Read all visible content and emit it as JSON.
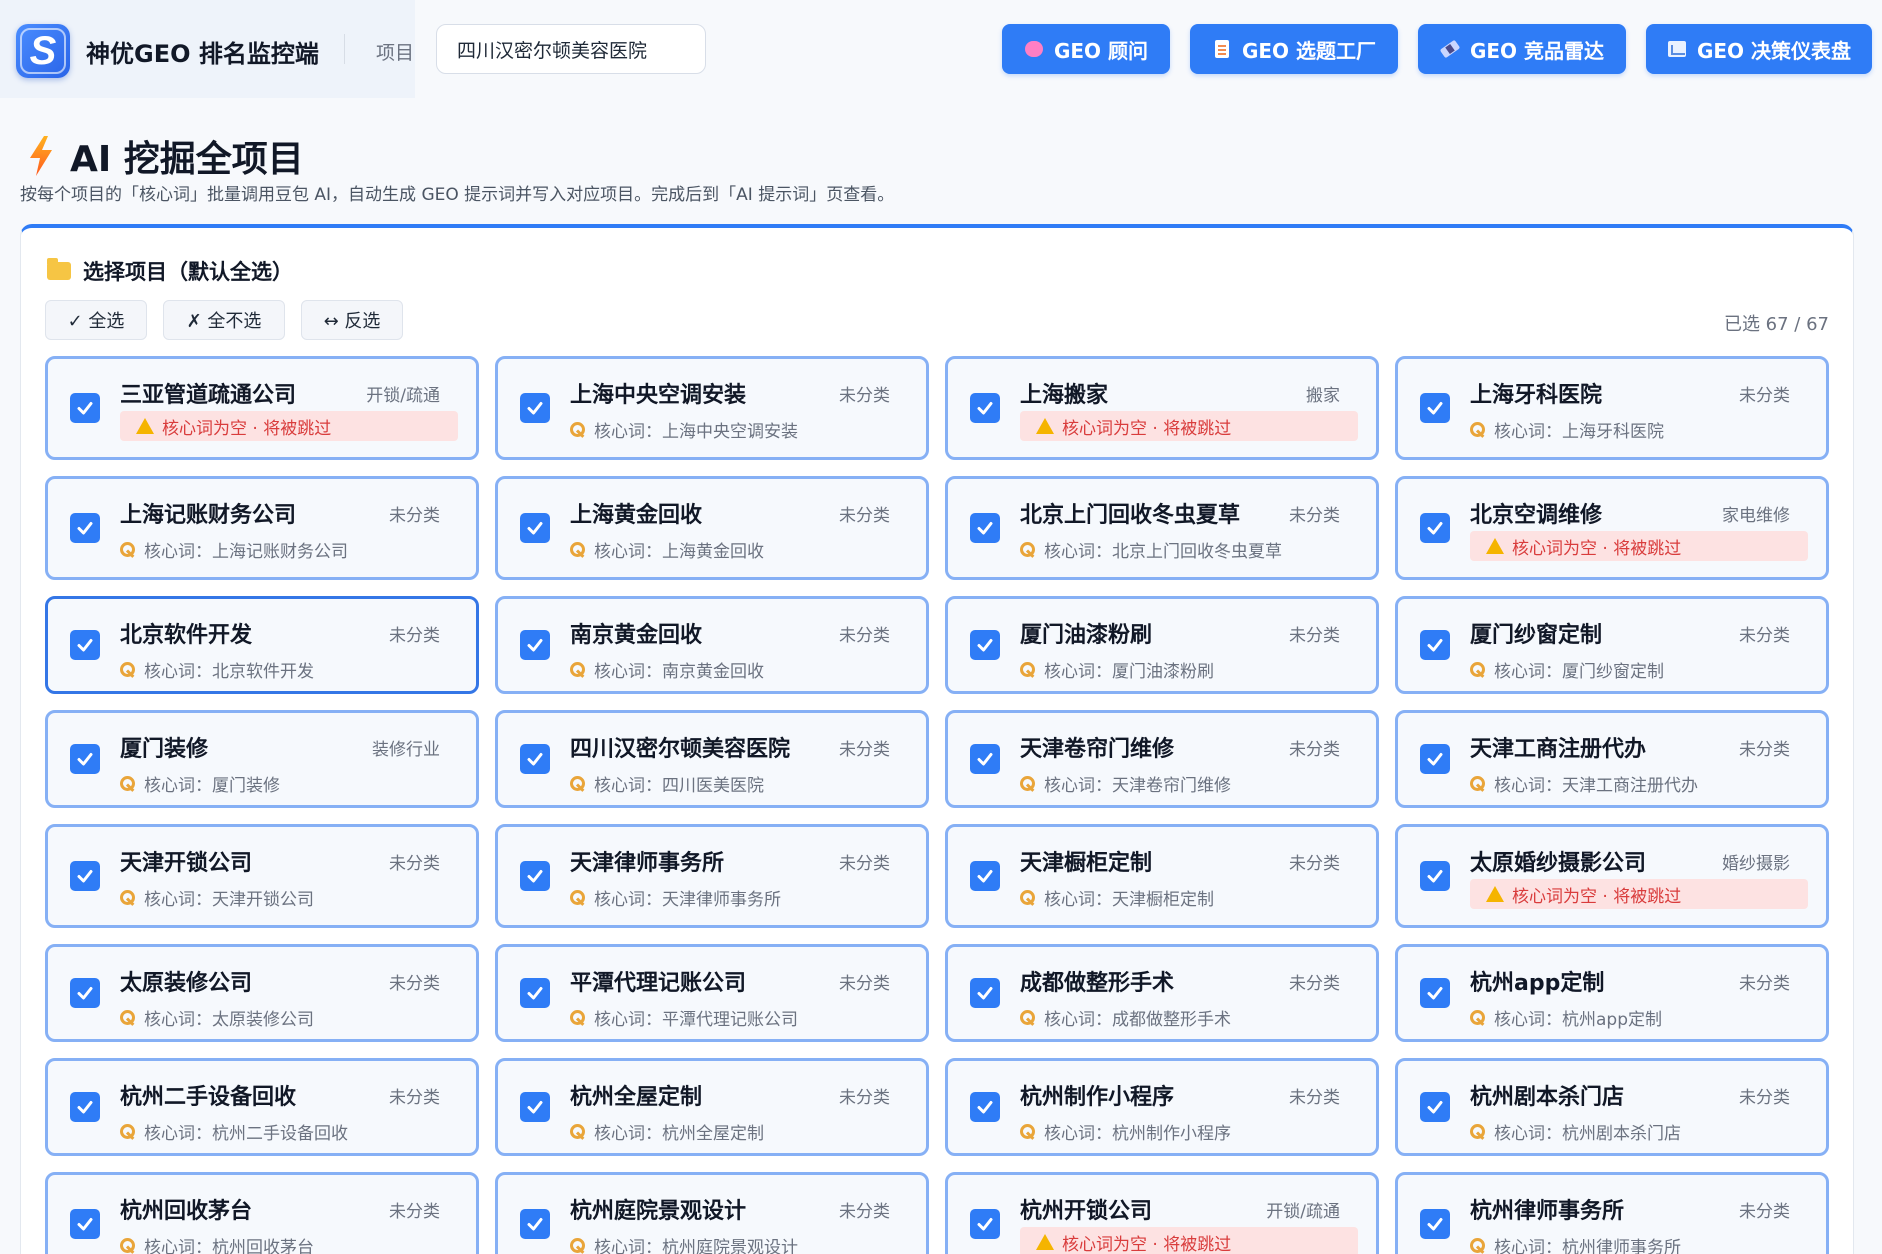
{
  "header": {
    "logo_letter": "S",
    "app_title": "神优GEO 排名监控端",
    "project_label": "项目",
    "project_value": "四川汉密尔顿美容医院",
    "nav": [
      {
        "label": "GEO 顾问",
        "icon": "brain-icon"
      },
      {
        "label": "GEO 选题工厂",
        "icon": "document-icon"
      },
      {
        "label": "GEO 竞品雷达",
        "icon": "satellite-icon"
      },
      {
        "label": "GEO 决策仪表盘",
        "icon": "chart-icon"
      }
    ]
  },
  "page": {
    "title": "AI 挖掘全项目",
    "subtitle": "按每个项目的「核心词」批量调用豆包 AI，自动生成 GEO 提示词并写入对应项目。完成后到「AI 提示词」页查看。"
  },
  "panel": {
    "heading": "选择项目（默认全选）",
    "select_all": "✓ 全选",
    "select_none": "✗ 全不选",
    "invert": "↔ 反选",
    "count": "已选 67 / 67"
  },
  "labels": {
    "keyword_prefix": "核心词：",
    "empty_warning": "核心词为空 · 将被跳过"
  },
  "projects": [
    {
      "name": "三亚管道疏通公司",
      "category": "开锁/疏通",
      "keyword": "",
      "empty": true
    },
    {
      "name": "上海中央空调安装",
      "category": "未分类",
      "keyword": "上海中央空调安装",
      "empty": false
    },
    {
      "name": "上海搬家",
      "category": "搬家",
      "keyword": "",
      "empty": true
    },
    {
      "name": "上海牙科医院",
      "category": "未分类",
      "keyword": "上海牙科医院",
      "empty": false
    },
    {
      "name": "上海记账财务公司",
      "category": "未分类",
      "keyword": "上海记账财务公司",
      "empty": false
    },
    {
      "name": "上海黄金回收",
      "category": "未分类",
      "keyword": "上海黄金回收",
      "empty": false
    },
    {
      "name": "北京上门回收冬虫夏草",
      "category": "未分类",
      "keyword": "北京上门回收冬虫夏草",
      "empty": false
    },
    {
      "name": "北京空调维修",
      "category": "家电维修",
      "keyword": "",
      "empty": true
    },
    {
      "name": "北京软件开发",
      "category": "未分类",
      "keyword": "北京软件开发",
      "empty": false
    },
    {
      "name": "南京黄金回收",
      "category": "未分类",
      "keyword": "南京黄金回收",
      "empty": false
    },
    {
      "name": "厦门油漆粉刷",
      "category": "未分类",
      "keyword": "厦门油漆粉刷",
      "empty": false
    },
    {
      "name": "厦门纱窗定制",
      "category": "未分类",
      "keyword": "厦门纱窗定制",
      "empty": false
    },
    {
      "name": "厦门装修",
      "category": "装修行业",
      "keyword": "厦门装修",
      "empty": false
    },
    {
      "name": "四川汉密尔顿美容医院",
      "category": "未分类",
      "keyword": "四川医美医院",
      "empty": false
    },
    {
      "name": "天津卷帘门维修",
      "category": "未分类",
      "keyword": "天津卷帘门维修",
      "empty": false
    },
    {
      "name": "天津工商注册代办",
      "category": "未分类",
      "keyword": "天津工商注册代办",
      "empty": false
    },
    {
      "name": "天津开锁公司",
      "category": "未分类",
      "keyword": "天津开锁公司",
      "empty": false
    },
    {
      "name": "天津律师事务所",
      "category": "未分类",
      "keyword": "天津律师事务所",
      "empty": false
    },
    {
      "name": "天津橱柜定制",
      "category": "未分类",
      "keyword": "天津橱柜定制",
      "empty": false
    },
    {
      "name": "太原婚纱摄影公司",
      "category": "婚纱摄影",
      "keyword": "",
      "empty": true
    },
    {
      "name": "太原装修公司",
      "category": "未分类",
      "keyword": "太原装修公司",
      "empty": false
    },
    {
      "name": "平潭代理记账公司",
      "category": "未分类",
      "keyword": "平潭代理记账公司",
      "empty": false
    },
    {
      "name": "成都做整形手术",
      "category": "未分类",
      "keyword": "成都做整形手术",
      "empty": false
    },
    {
      "name": "杭州app定制",
      "category": "未分类",
      "keyword": "杭州app定制",
      "empty": false
    },
    {
      "name": "杭州二手设备回收",
      "category": "未分类",
      "keyword": "杭州二手设备回收",
      "empty": false
    },
    {
      "name": "杭州全屋定制",
      "category": "未分类",
      "keyword": "杭州全屋定制",
      "empty": false
    },
    {
      "name": "杭州制作小程序",
      "category": "未分类",
      "keyword": "杭州制作小程序",
      "empty": false
    },
    {
      "name": "杭州剧本杀门店",
      "category": "未分类",
      "keyword": "杭州剧本杀门店",
      "empty": false
    },
    {
      "name": "杭州回收茅台",
      "category": "未分类",
      "keyword": "杭州回收茅台",
      "empty": false
    },
    {
      "name": "杭州庭院景观设计",
      "category": "未分类",
      "keyword": "杭州庭院景观设计",
      "empty": false
    },
    {
      "name": "杭州开锁公司",
      "category": "开锁/疏通",
      "keyword": "",
      "empty": true
    },
    {
      "name": "杭州律师事务所",
      "category": "未分类",
      "keyword": "杭州律师事务所",
      "empty": false
    }
  ]
}
